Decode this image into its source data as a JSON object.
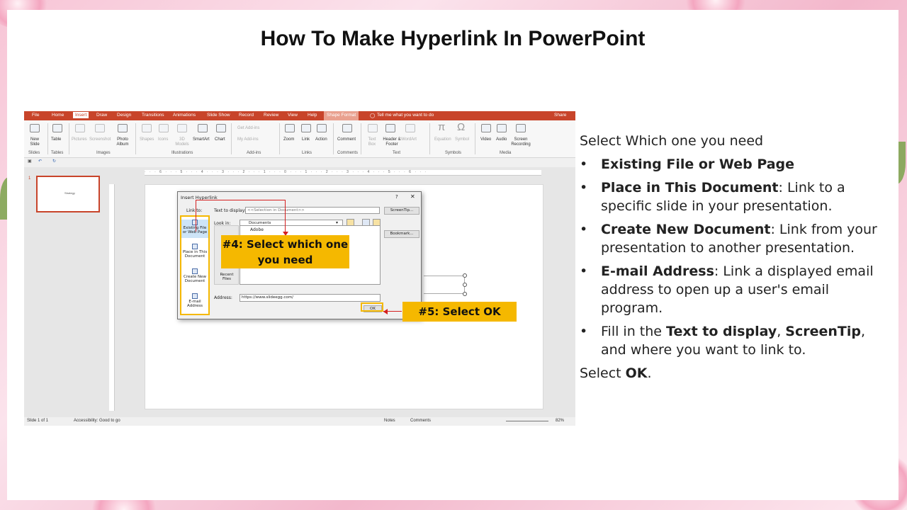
{
  "title": "How To Make Hyperlink In PowerPoint",
  "screenshot": {
    "tabs": [
      "File",
      "Home",
      "Insert",
      "Draw",
      "Design",
      "Transitions",
      "Animations",
      "Slide Show",
      "Record",
      "Review",
      "View",
      "Help",
      "Shape Format"
    ],
    "active_tab": "Insert",
    "tell_me": "Tell me what you want to do",
    "share": "Share",
    "ribbon": {
      "new_slide": "New Slide",
      "table": "Table",
      "pictures": "Pictures",
      "screenshot": "Screenshot",
      "photo_album": "Photo Album",
      "shapes": "Shapes",
      "icons": "Icons",
      "models_3d": "3D Models",
      "smartart": "SmartArt",
      "chart": "Chart",
      "get_addins": "Get Add-ins",
      "my_addins": "My Add-ins",
      "zoom": "Zoom",
      "link": "Link",
      "action": "Action",
      "comment": "Comment",
      "text_box": "Text Box",
      "header_footer": "Header & Footer",
      "wordart": "WordArt",
      "equation": "Equation",
      "symbol": "Symbol",
      "video": "Video",
      "audio": "Audio",
      "screen_recording": "Screen Recording",
      "groups": [
        "Slides",
        "Tables",
        "Images",
        "Illustrations",
        "Add-ins",
        "Links",
        "Comments",
        "Text",
        "Symbols",
        "Media"
      ]
    },
    "slide_number": "1",
    "thumb_text": "Strategy",
    "dialog": {
      "title": "Insert Hyperlink",
      "question": "?",
      "link_to": "Link to:",
      "text_to_display_label": "Text to display:",
      "text_to_display_value": "<<Selection in Document>>",
      "screentip": "ScreenTip...",
      "look_in_label": "Look in:",
      "look_in_value": "Documents",
      "bookmark": "Bookmark...",
      "first_file": "Adobe",
      "recent_files": "Recent Files",
      "address_label": "Address:",
      "address_value": "https://www.slideegg.com/",
      "ok": "OK",
      "link_options": [
        "Existing File or Web Page",
        "Place in This Document",
        "Create New Document",
        "E-mail Address"
      ]
    },
    "callout4": "#4: Select which one you need",
    "callout5": "#5: Select OK",
    "status": {
      "slide": "Slide 1 of 1",
      "accessibility": "Accessibility: Good to go",
      "notes": "Notes",
      "comments": "Comments",
      "zoom": "82%"
    }
  },
  "instructions": {
    "intro": "Select Which one you need",
    "items": [
      {
        "bold": "Existing File or Web Page",
        "rest": ""
      },
      {
        "bold": "Place in This Document",
        "rest": ": Link to a specific slide in your presentation."
      },
      {
        "bold": "Create New Document",
        "rest": ": Link from your presentation to another presentation."
      },
      {
        "bold": "E-mail Address",
        "rest": ": Link a displayed email address to open up a user's email program."
      }
    ],
    "fill_prefix": "Fill in the ",
    "fill_b1": "Text to display",
    "fill_sep": ", ",
    "fill_b2": "ScreenTip",
    "fill_suffix": ", and where you want to link to.",
    "outro_prefix": "Select ",
    "outro_bold": "OK",
    "outro_suffix": "."
  },
  "colors": {
    "accent": "#c8442a",
    "callout": "#f5b800",
    "pointer": "#d42020"
  }
}
